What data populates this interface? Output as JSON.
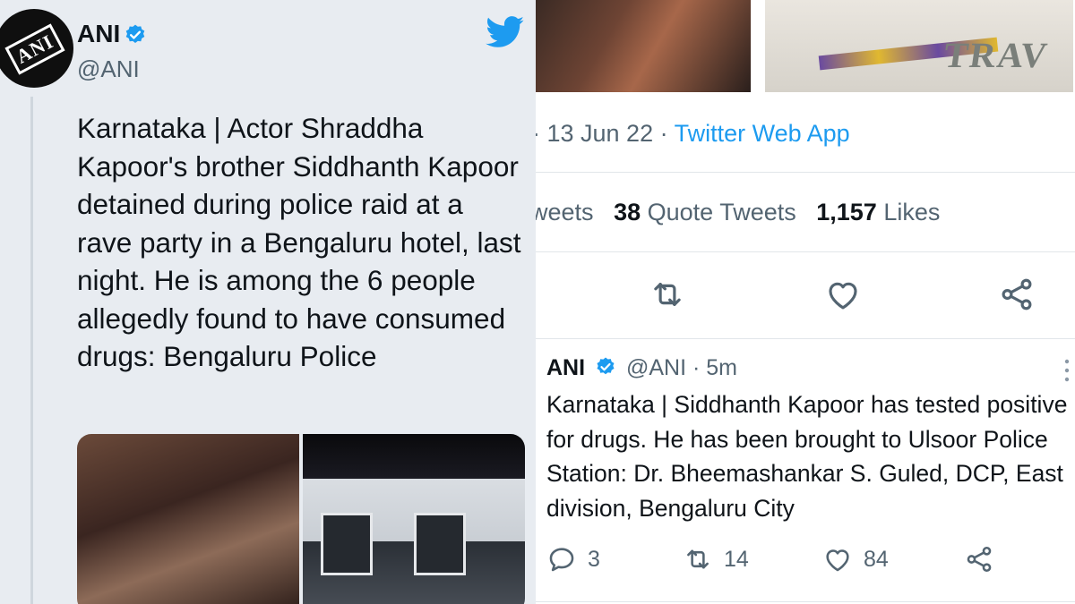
{
  "original_tweet": {
    "author_name": "ANI",
    "handle": "@ANI",
    "avatar_text": "ANI",
    "text": "Karnataka | Actor Shraddha Kapoor's brother Siddhanth Kapoor detained during police raid at a rave party in a Bengaluru hotel, last night. He is among the 6 people allegedly found to have consumed drugs: Bengaluru Police",
    "date_partial": "· 13 Jun 22 ·",
    "source_app": "Twitter Web App",
    "stats": {
      "retweets_partial_label": "weets",
      "quote_tweets_count": "38",
      "quote_tweets_label": "Quote Tweets",
      "likes_count": "1,157",
      "likes_label": "Likes"
    },
    "travel_sign_text": "TRAV"
  },
  "reply_tweet": {
    "author_name": "ANI",
    "handle": "@ANI",
    "time_ago": "· 5m",
    "text": "Karnataka | Siddhanth Kapoor has tested positive for drugs. He has been brought to Ulsoor Police Station: Dr. Bheemashankar S. Guled, DCP, East division, Bengaluru City",
    "reply_count": "3",
    "retweet_count": "14",
    "like_count": "84"
  },
  "colors": {
    "twitter_blue": "#1d9bf0",
    "text_primary": "#0f1419",
    "text_secondary": "#536471",
    "left_bg": "#e8ecf1"
  },
  "icons": [
    "twitter-bird-icon",
    "verified-badge-icon",
    "retweet-icon",
    "heart-icon",
    "share-icon",
    "reply-icon",
    "more-icon"
  ]
}
